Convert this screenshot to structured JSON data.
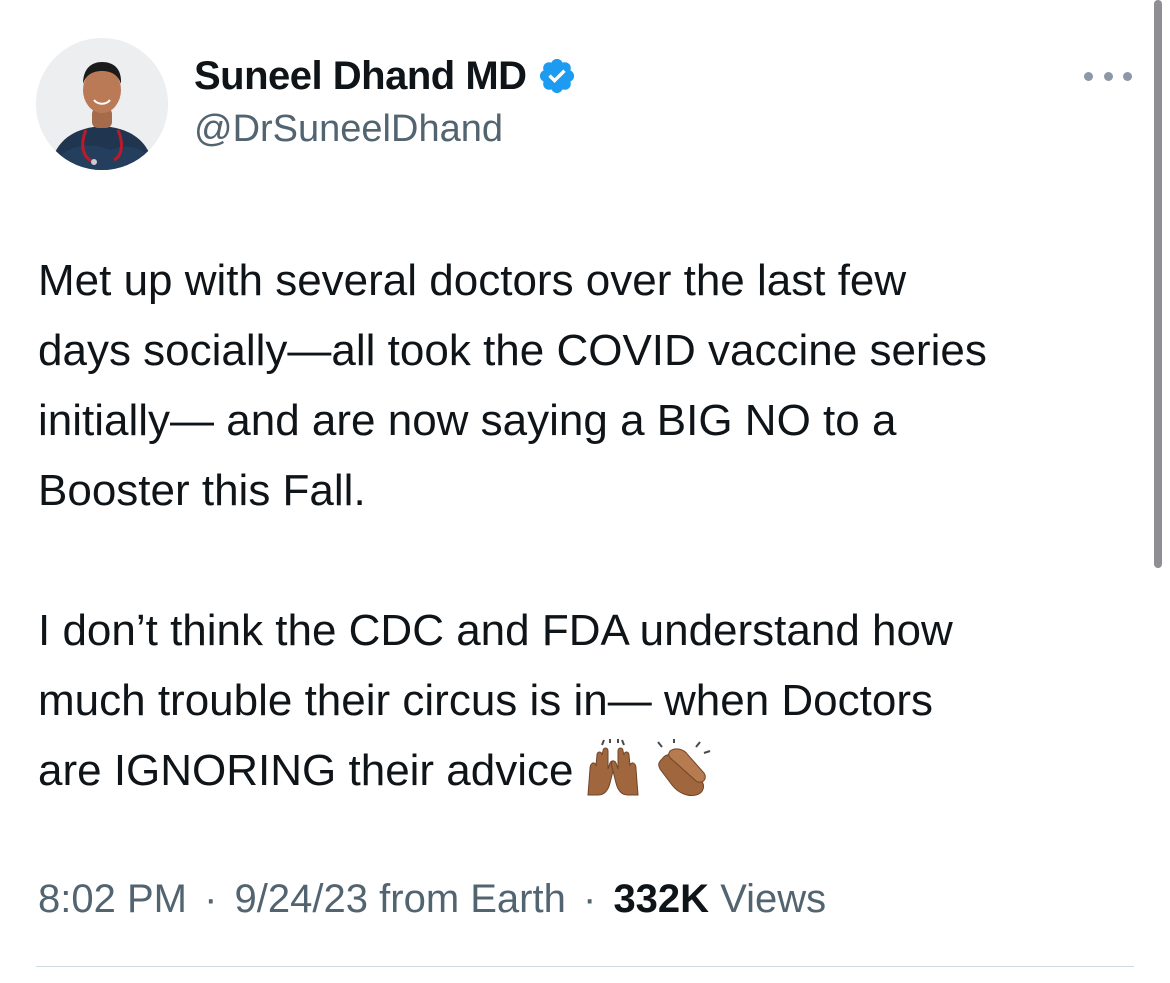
{
  "author": {
    "display_name": "Suneel Dhand MD",
    "handle": "@DrSuneelDhand",
    "verified_color": "#1d9bf0"
  },
  "icons": {
    "avatar": "profile-photo",
    "verified": "verified-badge-icon",
    "more": "more-options-icon",
    "emoji_1": "raising-hands-emoji",
    "emoji_2": "clapping-hands-emoji"
  },
  "tweet": {
    "paragraph_1": "Met up with several doctors over the last few\ndays socially—all took the COVID vaccine series\ninitially— and are now saying a BIG NO to a\nBooster this Fall.",
    "paragraph_2": "I don’t think the CDC and FDA understand how\nmuch trouble their circus is in— when Doctors\nare IGNORING their advice"
  },
  "meta": {
    "time": "8:02 PM",
    "separator": "·",
    "date": "9/24/23",
    "source": "from Earth",
    "views_count": "332K",
    "views_label": "Views"
  },
  "colors": {
    "text_primary": "#0f1419",
    "text_secondary": "#536471",
    "divider": "#cfd9de",
    "accent": "#1d9bf0"
  }
}
